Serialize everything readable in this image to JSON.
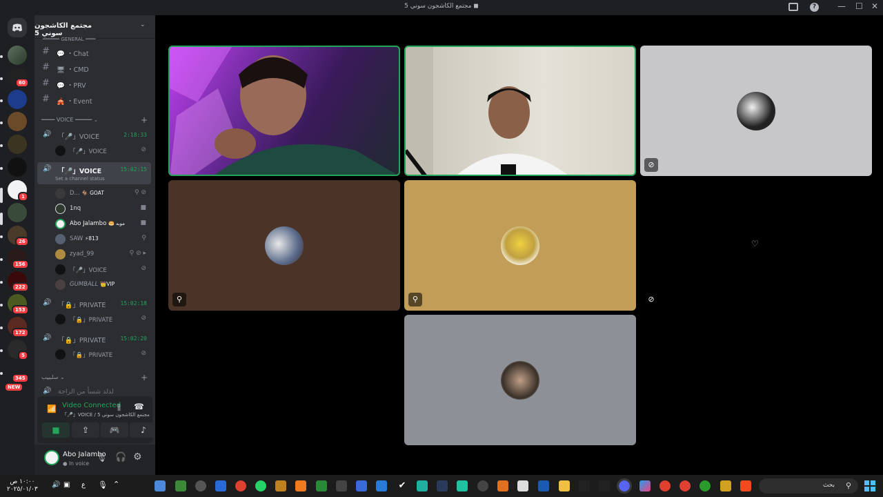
{
  "window": {
    "title": "مجتمع الكاشجون سوني 5 ◼"
  },
  "server": {
    "name": "مجتمع الكاشجون سوني 5"
  },
  "server_badges": [
    "60",
    "1",
    "26",
    "156",
    "222",
    "153",
    "172",
    "5",
    "345",
    "NEW"
  ],
  "channels": {
    "category_general": "GENERAL",
    "text": [
      {
        "emoji": "💬",
        "label": "・Chat"
      },
      {
        "emoji": "🖥",
        "label": "・CMD"
      },
      {
        "emoji": "💬",
        "label": "・PRV"
      },
      {
        "emoji": "🎪",
        "label": "・Event"
      }
    ],
    "category_voice": "VOICE",
    "voice": [
      {
        "label": "「🎤」VOICE",
        "time": "2:18:33",
        "sub": "「🎤」VOICE"
      },
      {
        "label": "「🎤」VOICE",
        "time": "15:02:15",
        "status": "Set a channel status"
      }
    ],
    "members": [
      {
        "name": "D...",
        "tag": "🐐 GOAT"
      },
      {
        "name": "1nq",
        "tag": ""
      },
      {
        "name": "Abo Jalambo",
        "tag": "🥯 موبه"
      },
      {
        "name": "SAW",
        "tag": "⚡813"
      },
      {
        "name": "zyad_99",
        "tag": ""
      },
      {
        "name": "「🎤」VOICE",
        "tag": ""
      },
      {
        "name": "GUMBALL",
        "tag": "👑VIP"
      }
    ],
    "private": [
      {
        "label": "「🔒」PRIVATE",
        "time": "15:02:18",
        "sub": "「🔒」PRIVATE"
      },
      {
        "label": "「🔒」PRIVATE",
        "time": "15:02:20",
        "sub": "「🔒」PRIVATE"
      }
    ],
    "category_other": "سلبييب",
    "other_channel": "لذلذ شسأ من الراحة"
  },
  "voice_panel": {
    "status": "Video Connected",
    "channel": "「🎤」VOICE / مجتمع الكاشجون سوني 5"
  },
  "user": {
    "name": "Abo Jalambo",
    "status": "In voice"
  },
  "colors": {
    "accent_green": "#23a55a",
    "danger": "#f23f43",
    "blurple": "#5865f2",
    "tile_brown": "#4a3427",
    "tile_gold": "#c29d58",
    "tile_gray": "#8e9097",
    "tile_light": "#c7c7c9"
  },
  "taskbar": {
    "time": "١٠:٠٠ ص",
    "date": "٢٠٢٥/٠١/٠٣",
    "lang": "ع",
    "search_placeholder": "بحث"
  }
}
